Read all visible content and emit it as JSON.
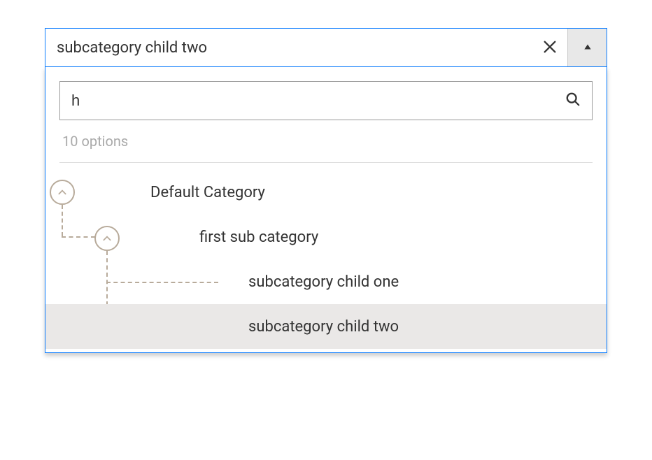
{
  "dropdown": {
    "selected_value": "subcategory child two",
    "icons": {
      "clear": "close-icon",
      "toggle": "caret-up-icon"
    }
  },
  "search": {
    "value": "h",
    "icon": "search-icon"
  },
  "options_label": "10 options",
  "tree": {
    "items": [
      {
        "label": "Default Category",
        "expandable": true
      },
      {
        "label": "first sub category",
        "expandable": true
      },
      {
        "label": "subcategory child one",
        "expandable": false
      },
      {
        "label": "subcategory child two",
        "expandable": false,
        "selected": true
      }
    ]
  }
}
